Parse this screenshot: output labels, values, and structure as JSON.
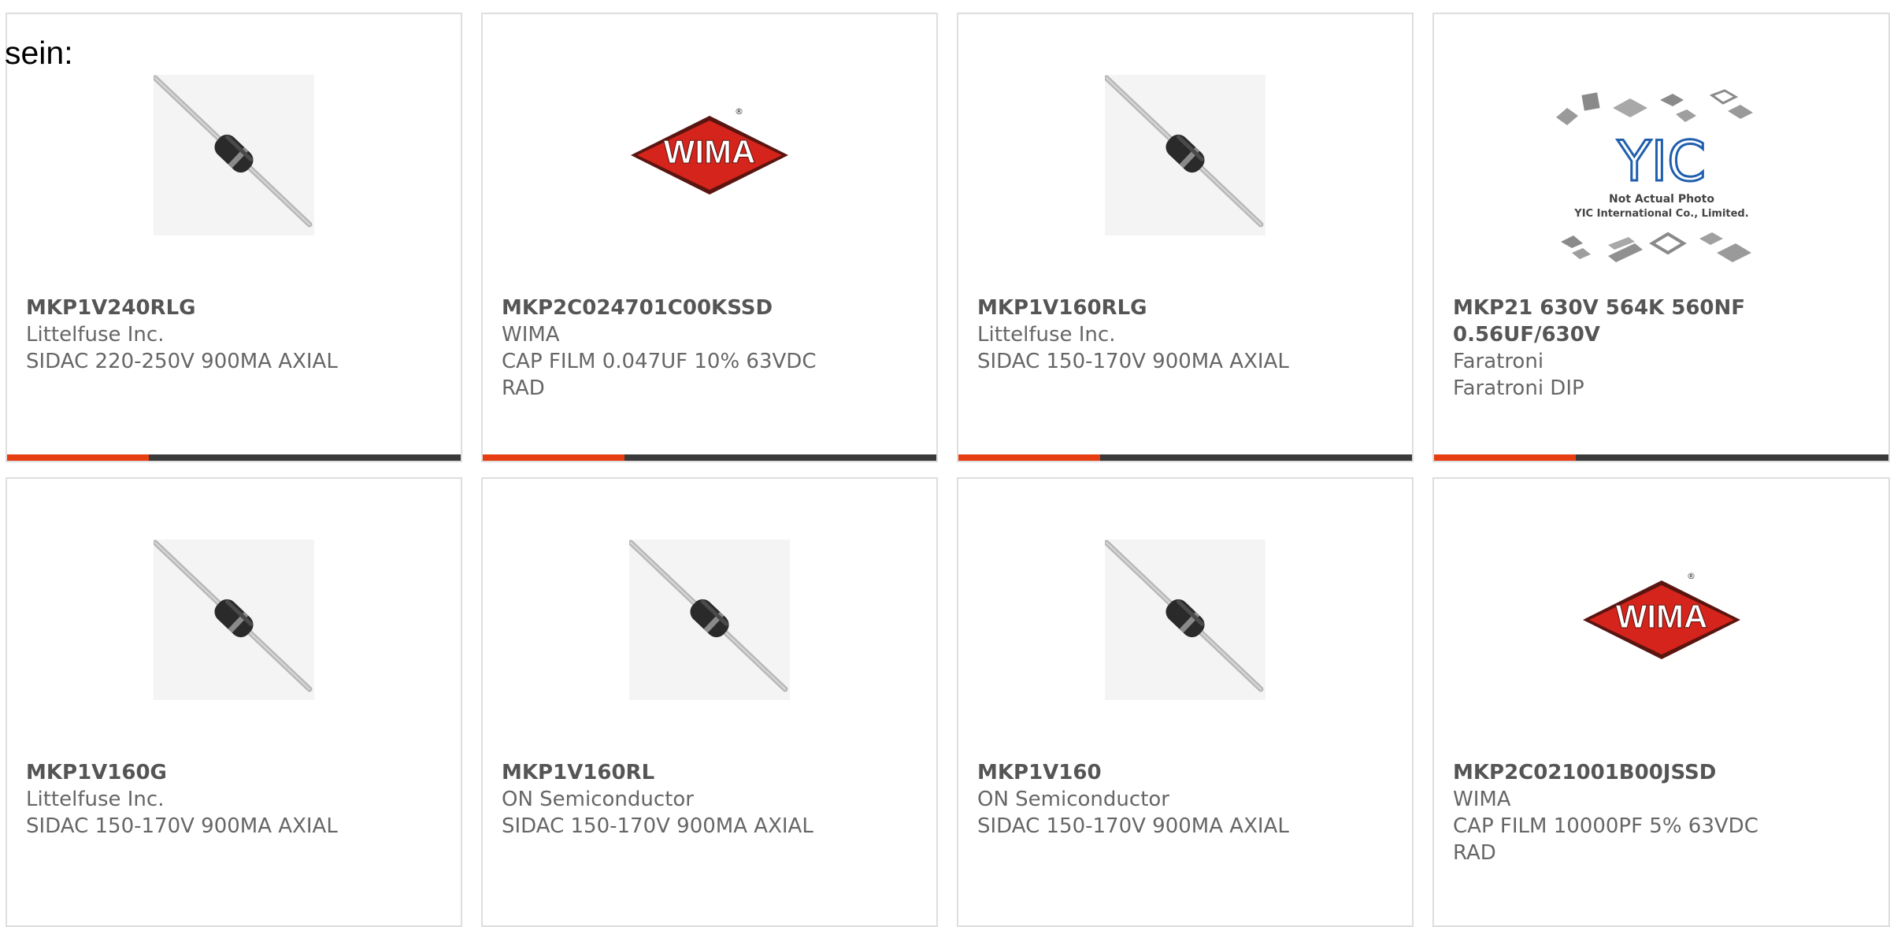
{
  "leading_text": "sein:",
  "colors": {
    "accent": "#e63e12",
    "bar_dark": "#3a3a3a",
    "wima_red": "#d4241c",
    "yic_blue": "#1f5fae"
  },
  "products": [
    {
      "part_number": "MKP1V240RLG",
      "manufacturer": "Littelfuse Inc.",
      "description": "SIDAC 220-250V 900MA AXIAL",
      "image": "axial-diode"
    },
    {
      "part_number": "MKP2C024701C00KSSD",
      "manufacturer": "WIMA",
      "description": "CAP FILM 0.047UF 10% 63VDC RAD",
      "image": "wima-logo",
      "logo_text": "WIMA",
      "logo_mark": "®"
    },
    {
      "part_number": "MKP1V160RLG",
      "manufacturer": "Littelfuse Inc.",
      "description": "SIDAC 150-170V 900MA AXIAL",
      "image": "axial-diode"
    },
    {
      "part_number": "MKP21 630V 564K 560NF 0.56UF/630V",
      "manufacturer": "Faratroni",
      "description": "Faratroni DIP",
      "image": "yic-placeholder",
      "logo_text": "YIC",
      "caption_line1": "Not Actual Photo",
      "caption_line2": "YIC International Co., Limited."
    },
    {
      "part_number": "MKP1V160G",
      "manufacturer": "Littelfuse Inc.",
      "description": "SIDAC 150-170V 900MA AXIAL",
      "image": "axial-diode"
    },
    {
      "part_number": "MKP1V160RL",
      "manufacturer": "ON Semiconductor",
      "description": "SIDAC 150-170V 900MA AXIAL",
      "image": "axial-diode"
    },
    {
      "part_number": "MKP1V160",
      "manufacturer": "ON Semiconductor",
      "description": "SIDAC 150-170V 900MA AXIAL",
      "image": "axial-diode"
    },
    {
      "part_number": "MKP2C021001B00JSSD",
      "manufacturer": "WIMA",
      "description": "CAP FILM 10000PF 5% 63VDC RAD",
      "image": "wima-logo",
      "logo_text": "WIMA",
      "logo_mark": "®"
    }
  ]
}
